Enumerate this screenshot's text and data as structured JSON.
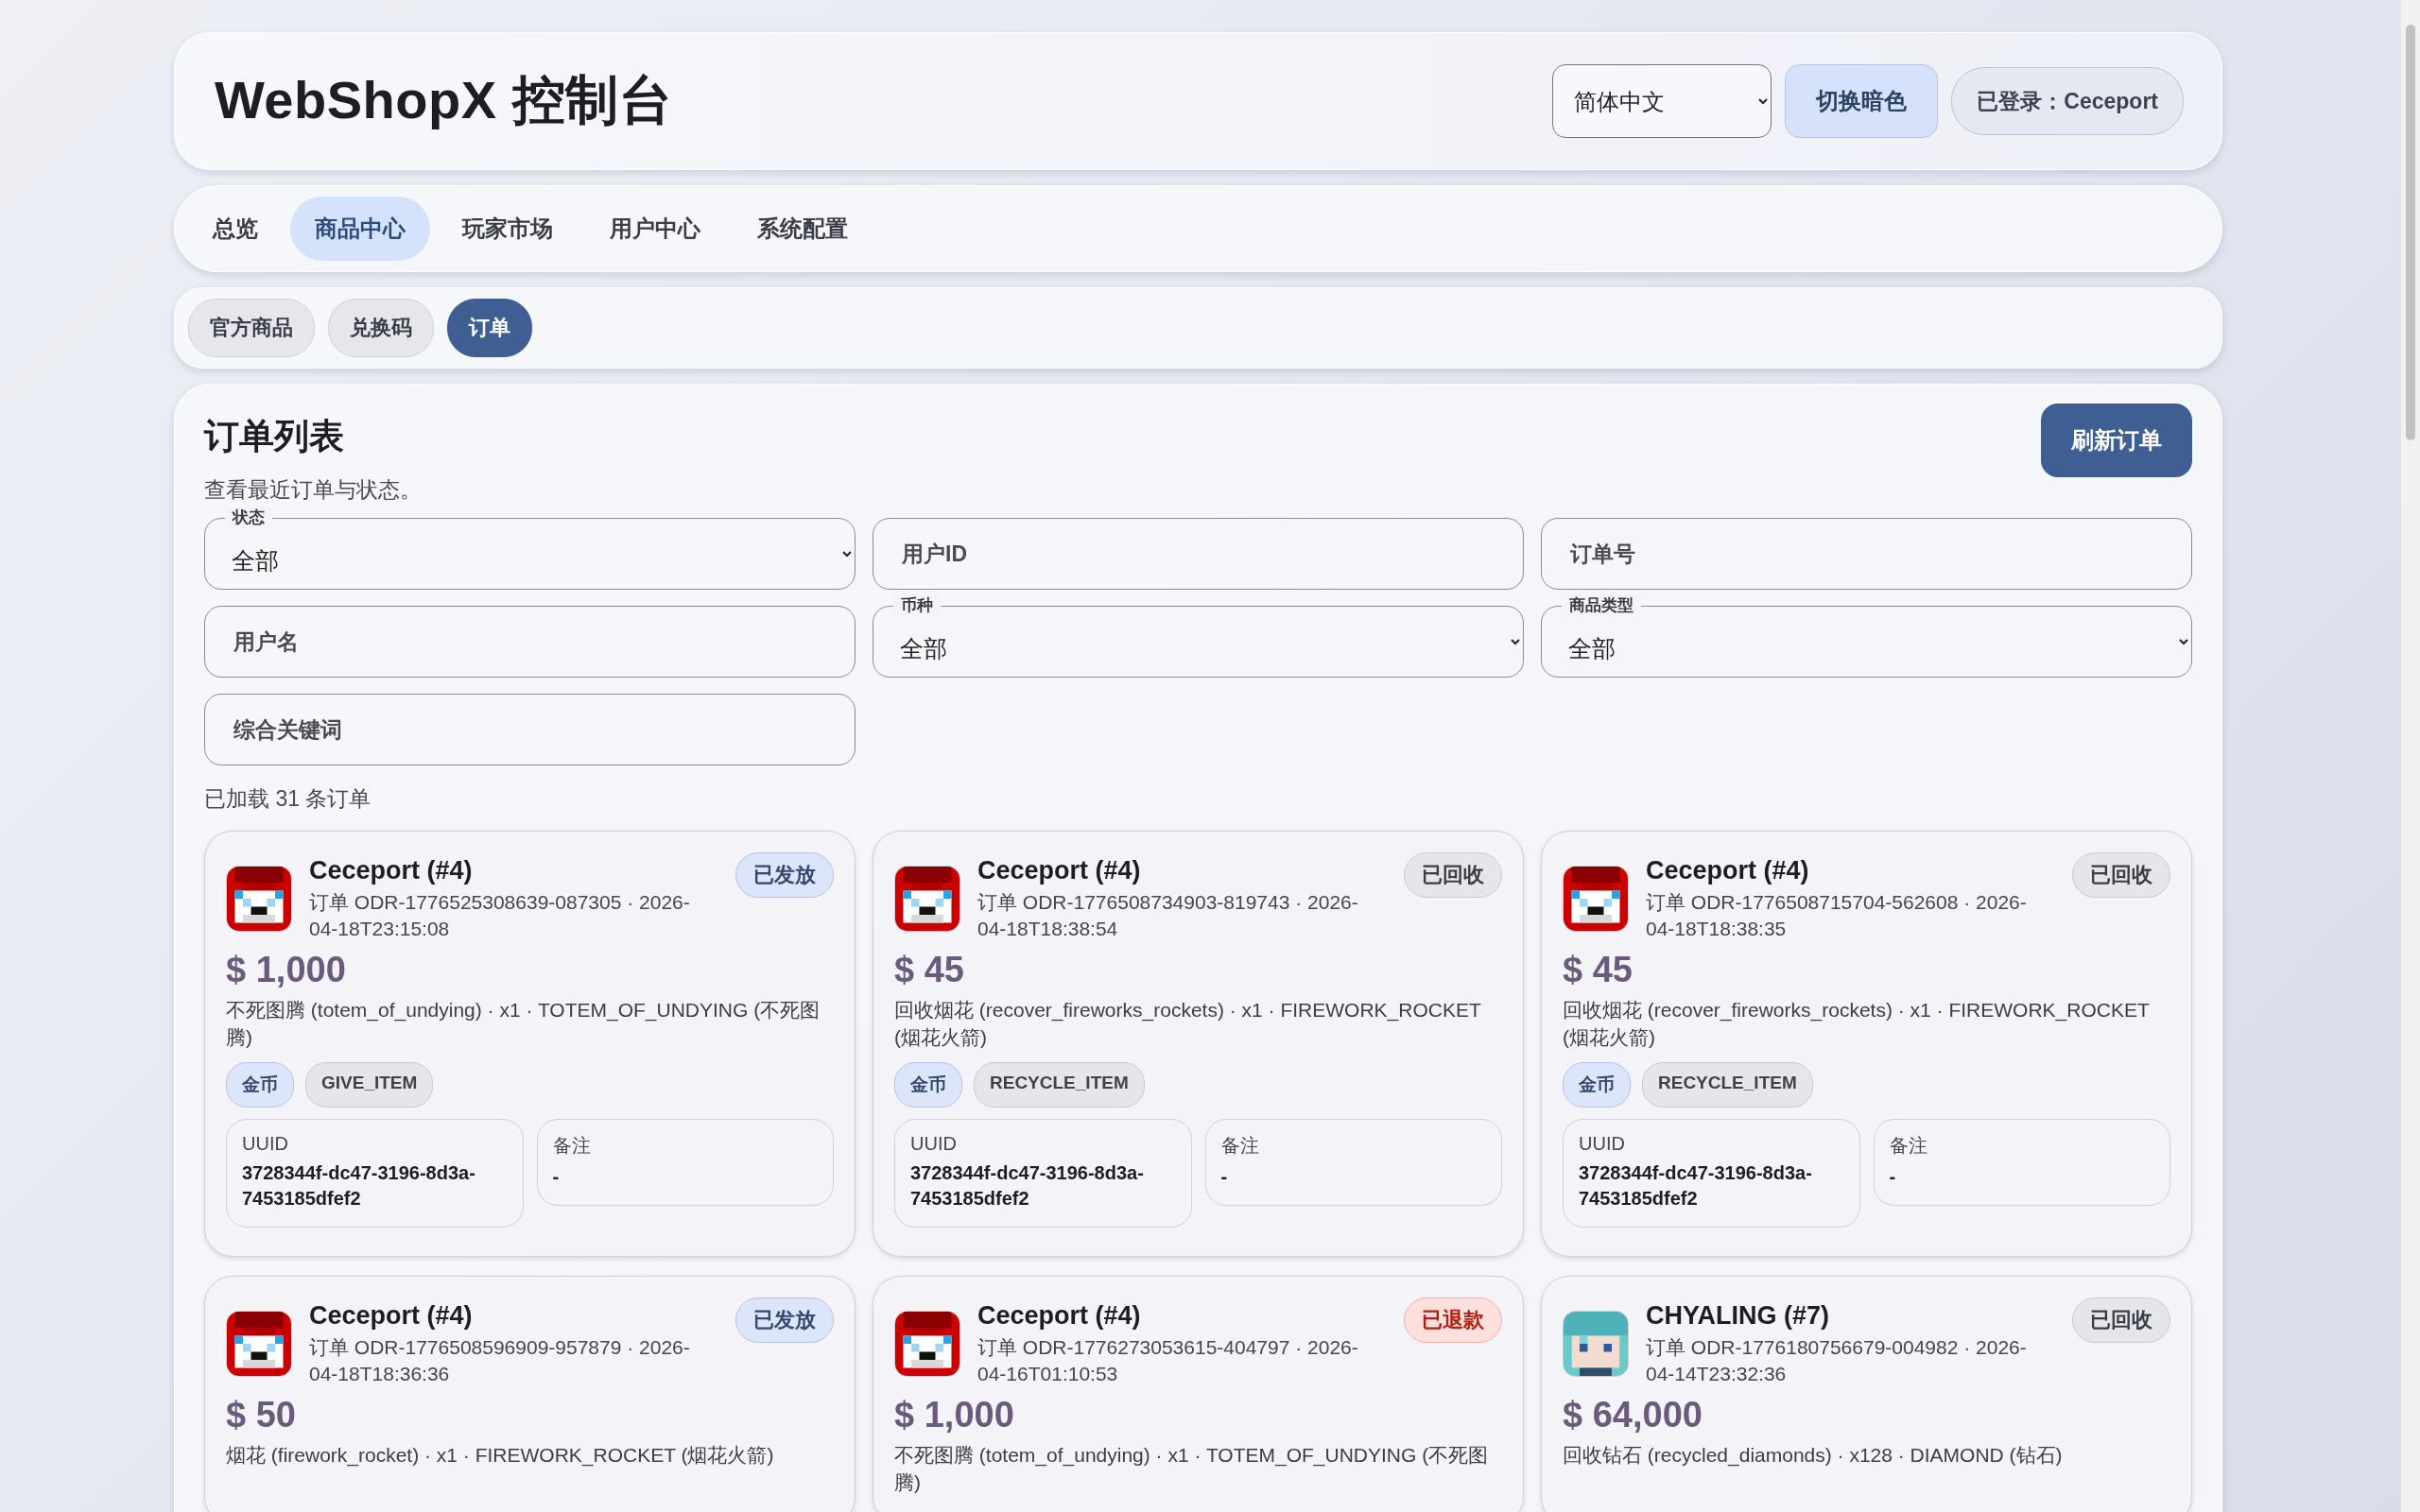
{
  "header": {
    "title": "WebShopX 控制台",
    "language": "简体中文",
    "theme_button": "切换暗色",
    "login": "已登录：Ceceport"
  },
  "tabs": [
    {
      "label": "总览",
      "selected": false
    },
    {
      "label": "商品中心",
      "selected": true
    },
    {
      "label": "玩家市场",
      "selected": false
    },
    {
      "label": "用户中心",
      "selected": false
    },
    {
      "label": "系统配置",
      "selected": false
    }
  ],
  "subtabs": [
    {
      "label": "官方商品",
      "selected": false
    },
    {
      "label": "兑换码",
      "selected": false
    },
    {
      "label": "订单",
      "selected": true
    }
  ],
  "panel": {
    "title": "订单列表",
    "subtitle": "查看最近订单与状态。",
    "refresh_button": "刷新订单",
    "filters": [
      {
        "kind": "select",
        "label": "状态",
        "value": "全部"
      },
      {
        "kind": "input",
        "placeholder": "用户ID"
      },
      {
        "kind": "input",
        "placeholder": "订单号"
      },
      {
        "kind": "input",
        "placeholder": "用户名"
      },
      {
        "kind": "select",
        "label": "币种",
        "value": "全部"
      },
      {
        "kind": "select",
        "label": "商品类型",
        "value": "全部"
      },
      {
        "kind": "input",
        "placeholder": "综合关键词"
      }
    ],
    "count": "已加载 31 条订单",
    "orders": [
      {
        "user": "Ceceport (#4)",
        "kind": "red",
        "order": "订单 ODR-1776525308639-087305 · 2026-04-18T23:15:08",
        "status": {
          "label": "已发放",
          "kind": "delivered"
        },
        "amount": "$ 1,000",
        "description": "不死图腾 (totem_of_undying) · x1 · TOTEM_OF_UNDYING (不死图腾)",
        "tags": [
          {
            "label": "金币",
            "kind": "currency"
          },
          {
            "label": "GIVE_ITEM",
            "kind": "type"
          }
        ],
        "uuid_label": "UUID",
        "uuid": "3728344f-dc47-3196-8d3a-7453185dfef2",
        "note_label": "备注",
        "note": "-"
      },
      {
        "user": "Ceceport (#4)",
        "kind": "red",
        "order": "订单 ODR-1776508734903-819743 · 2026-04-18T18:38:54",
        "status": {
          "label": "已回收",
          "kind": "recycled"
        },
        "amount": "$ 45",
        "description": "回收烟花 (recover_fireworks_rockets) · x1 · FIREWORK_ROCKET (烟花火箭)",
        "tags": [
          {
            "label": "金币",
            "kind": "currency"
          },
          {
            "label": "RECYCLE_ITEM",
            "kind": "type"
          }
        ],
        "uuid_label": "UUID",
        "uuid": "3728344f-dc47-3196-8d3a-7453185dfef2",
        "note_label": "备注",
        "note": "-"
      },
      {
        "user": "Ceceport (#4)",
        "kind": "red",
        "order": "订单 ODR-1776508715704-562608 · 2026-04-18T18:38:35",
        "status": {
          "label": "已回收",
          "kind": "recycled"
        },
        "amount": "$ 45",
        "description": "回收烟花 (recover_fireworks_rockets) · x1 · FIREWORK_ROCKET (烟花火箭)",
        "tags": [
          {
            "label": "金币",
            "kind": "currency"
          },
          {
            "label": "RECYCLE_ITEM",
            "kind": "type"
          }
        ],
        "uuid_label": "UUID",
        "uuid": "3728344f-dc47-3196-8d3a-7453185dfef2",
        "note_label": "备注",
        "note": "-"
      },
      {
        "user": "Ceceport (#4)",
        "kind": "red",
        "order": "订单 ODR-1776508596909-957879 · 2026-04-18T18:36:36",
        "status": {
          "label": "已发放",
          "kind": "delivered"
        },
        "amount": "$ 50",
        "description": "烟花 (firework_rocket) · x1 · FIREWORK_ROCKET (烟花火箭)"
      },
      {
        "user": "Ceceport (#4)",
        "kind": "red",
        "order": "订单 ODR-1776273053615-404797 · 2026-04-16T01:10:53",
        "status": {
          "label": "已退款",
          "kind": "refunded"
        },
        "amount": "$ 1,000",
        "description": "不死图腾 (totem_of_undying) · x1 · TOTEM_OF_UNDYING (不死图腾)"
      },
      {
        "user": "CHYALING (#7)",
        "kind": "teal",
        "order": "订单 ODR-1776180756679-004982 · 2026-04-14T23:32:36",
        "status": {
          "label": "已回收",
          "kind": "recycled"
        },
        "amount": "$ 64,000",
        "description": "回收钻石 (recycled_diamonds) · x128 · DIAMOND (钻石)"
      }
    ]
  }
}
